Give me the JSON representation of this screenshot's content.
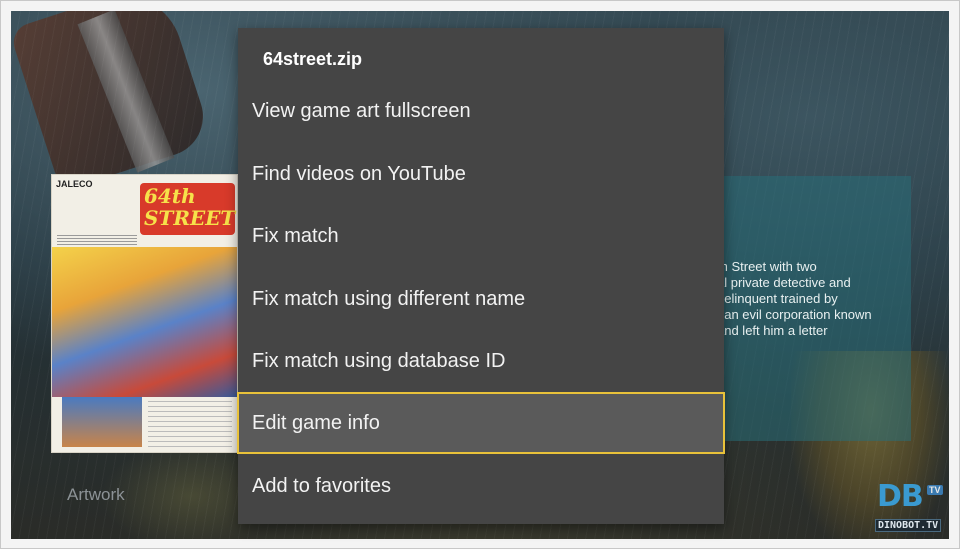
{
  "background": {
    "artwork_label": "Artwork",
    "description_lines": "th Street with two\nal private detective and\ndelinquent trained by\n, an evil corporation known\nand left him a letter",
    "boxart": {
      "brand": "JALECO",
      "logo_text": "64th STREET"
    }
  },
  "menu": {
    "title": "64street.zip",
    "items": [
      {
        "label": "View game art fullscreen"
      },
      {
        "label": "Find videos on YouTube"
      },
      {
        "label": "Fix match"
      },
      {
        "label": "Fix match using different name"
      },
      {
        "label": "Fix match using database ID"
      },
      {
        "label": "Edit game info",
        "focused": true
      },
      {
        "label": "Add to favorites"
      }
    ]
  },
  "watermark": {
    "letters": "DB",
    "badge": "TV",
    "sub": "DINOBOT.TV"
  },
  "colors": {
    "menu_bg": "#454545",
    "focus_border": "#e9c23a",
    "focus_bg": "#5a5a5a"
  }
}
